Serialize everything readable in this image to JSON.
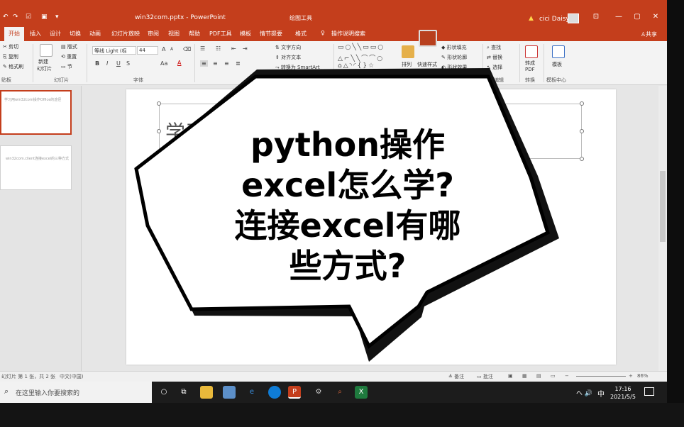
{
  "titlebar": {
    "doc_title": "win32com.pptx - PowerPoint",
    "context_tool": "绘图工具",
    "user": "cici Daisy",
    "qa_icons": [
      "↶",
      "↷",
      "☑",
      "▣",
      "▾"
    ],
    "min": "—",
    "restore": "▢",
    "close": "✕",
    "ribbon_opt": "⊡"
  },
  "tabs": [
    "开始",
    "插入",
    "设计",
    "切换",
    "动画",
    "幻灯片放映",
    "审阅",
    "视图",
    "帮助",
    "PDF工具",
    "模板",
    "情节提要",
    "格式"
  ],
  "tell_me": "操作说明搜索",
  "share": "共享",
  "ribbon": {
    "clipboard": {
      "cut": "剪切",
      "copy": "复制",
      "paste_fmt": "格式刷",
      "label": "贴板"
    },
    "slides": {
      "new": "新建",
      "new2": "幻灯片",
      "layout": "版式",
      "reset": "重置",
      "section": "节",
      "label": "幻灯片"
    },
    "font": {
      "name": "等线 Light (标",
      "size": "44",
      "label": "字体",
      "bold": "B",
      "italic": "I",
      "underline": "U",
      "strike": "S",
      "aa": "Aa",
      "font_color": "A",
      "grow": "A",
      "shrink": "A"
    },
    "paragraph": {
      "text_dir": "文字方向",
      "align_text": "对齐文本",
      "smartart": "转换为 SmartArt",
      "label": "段落"
    },
    "drawing": {
      "arrange": "排列",
      "quick_styles": "快速样式",
      "fill": "形状填充",
      "outline": "形状轮廓",
      "effect": "形状效果",
      "label": "绘图"
    },
    "editing": {
      "find": "查找",
      "replace": "替换",
      "select": "选择",
      "label": "编辑"
    },
    "convert": {
      "pdf": "转成\nPDF",
      "label": "转换"
    },
    "template": {
      "name": "模板",
      "label": "模板中心"
    }
  },
  "thumbnails": [
    {
      "num": "1",
      "text": "学习用win32com操作Office的途径"
    },
    {
      "num": "2",
      "text": "win32com.client连接excel的三种方式"
    }
  ],
  "slide": {
    "title": "学习用win32com操作Office的途径",
    "link": "docs"
  },
  "statusbar": {
    "slide_info": "幻灯片 第 1 张，共 2 张",
    "language": "中文(中国)",
    "notes": "备注",
    "comments": "批注",
    "zoom": "86%"
  },
  "taskbar": {
    "search_placeholder": "在这里输入你要搜索的",
    "ime": "中",
    "time": "17:16",
    "date": "2021/5/5",
    "tray": "へ 🔊"
  },
  "overlay": {
    "line1": "python操作",
    "line2": "excel怎么学?",
    "line3": "连接excel有哪",
    "line4": "些方式?"
  },
  "colors": {
    "accent": "#c43e1c",
    "taskbar": "#1c1c1c"
  }
}
